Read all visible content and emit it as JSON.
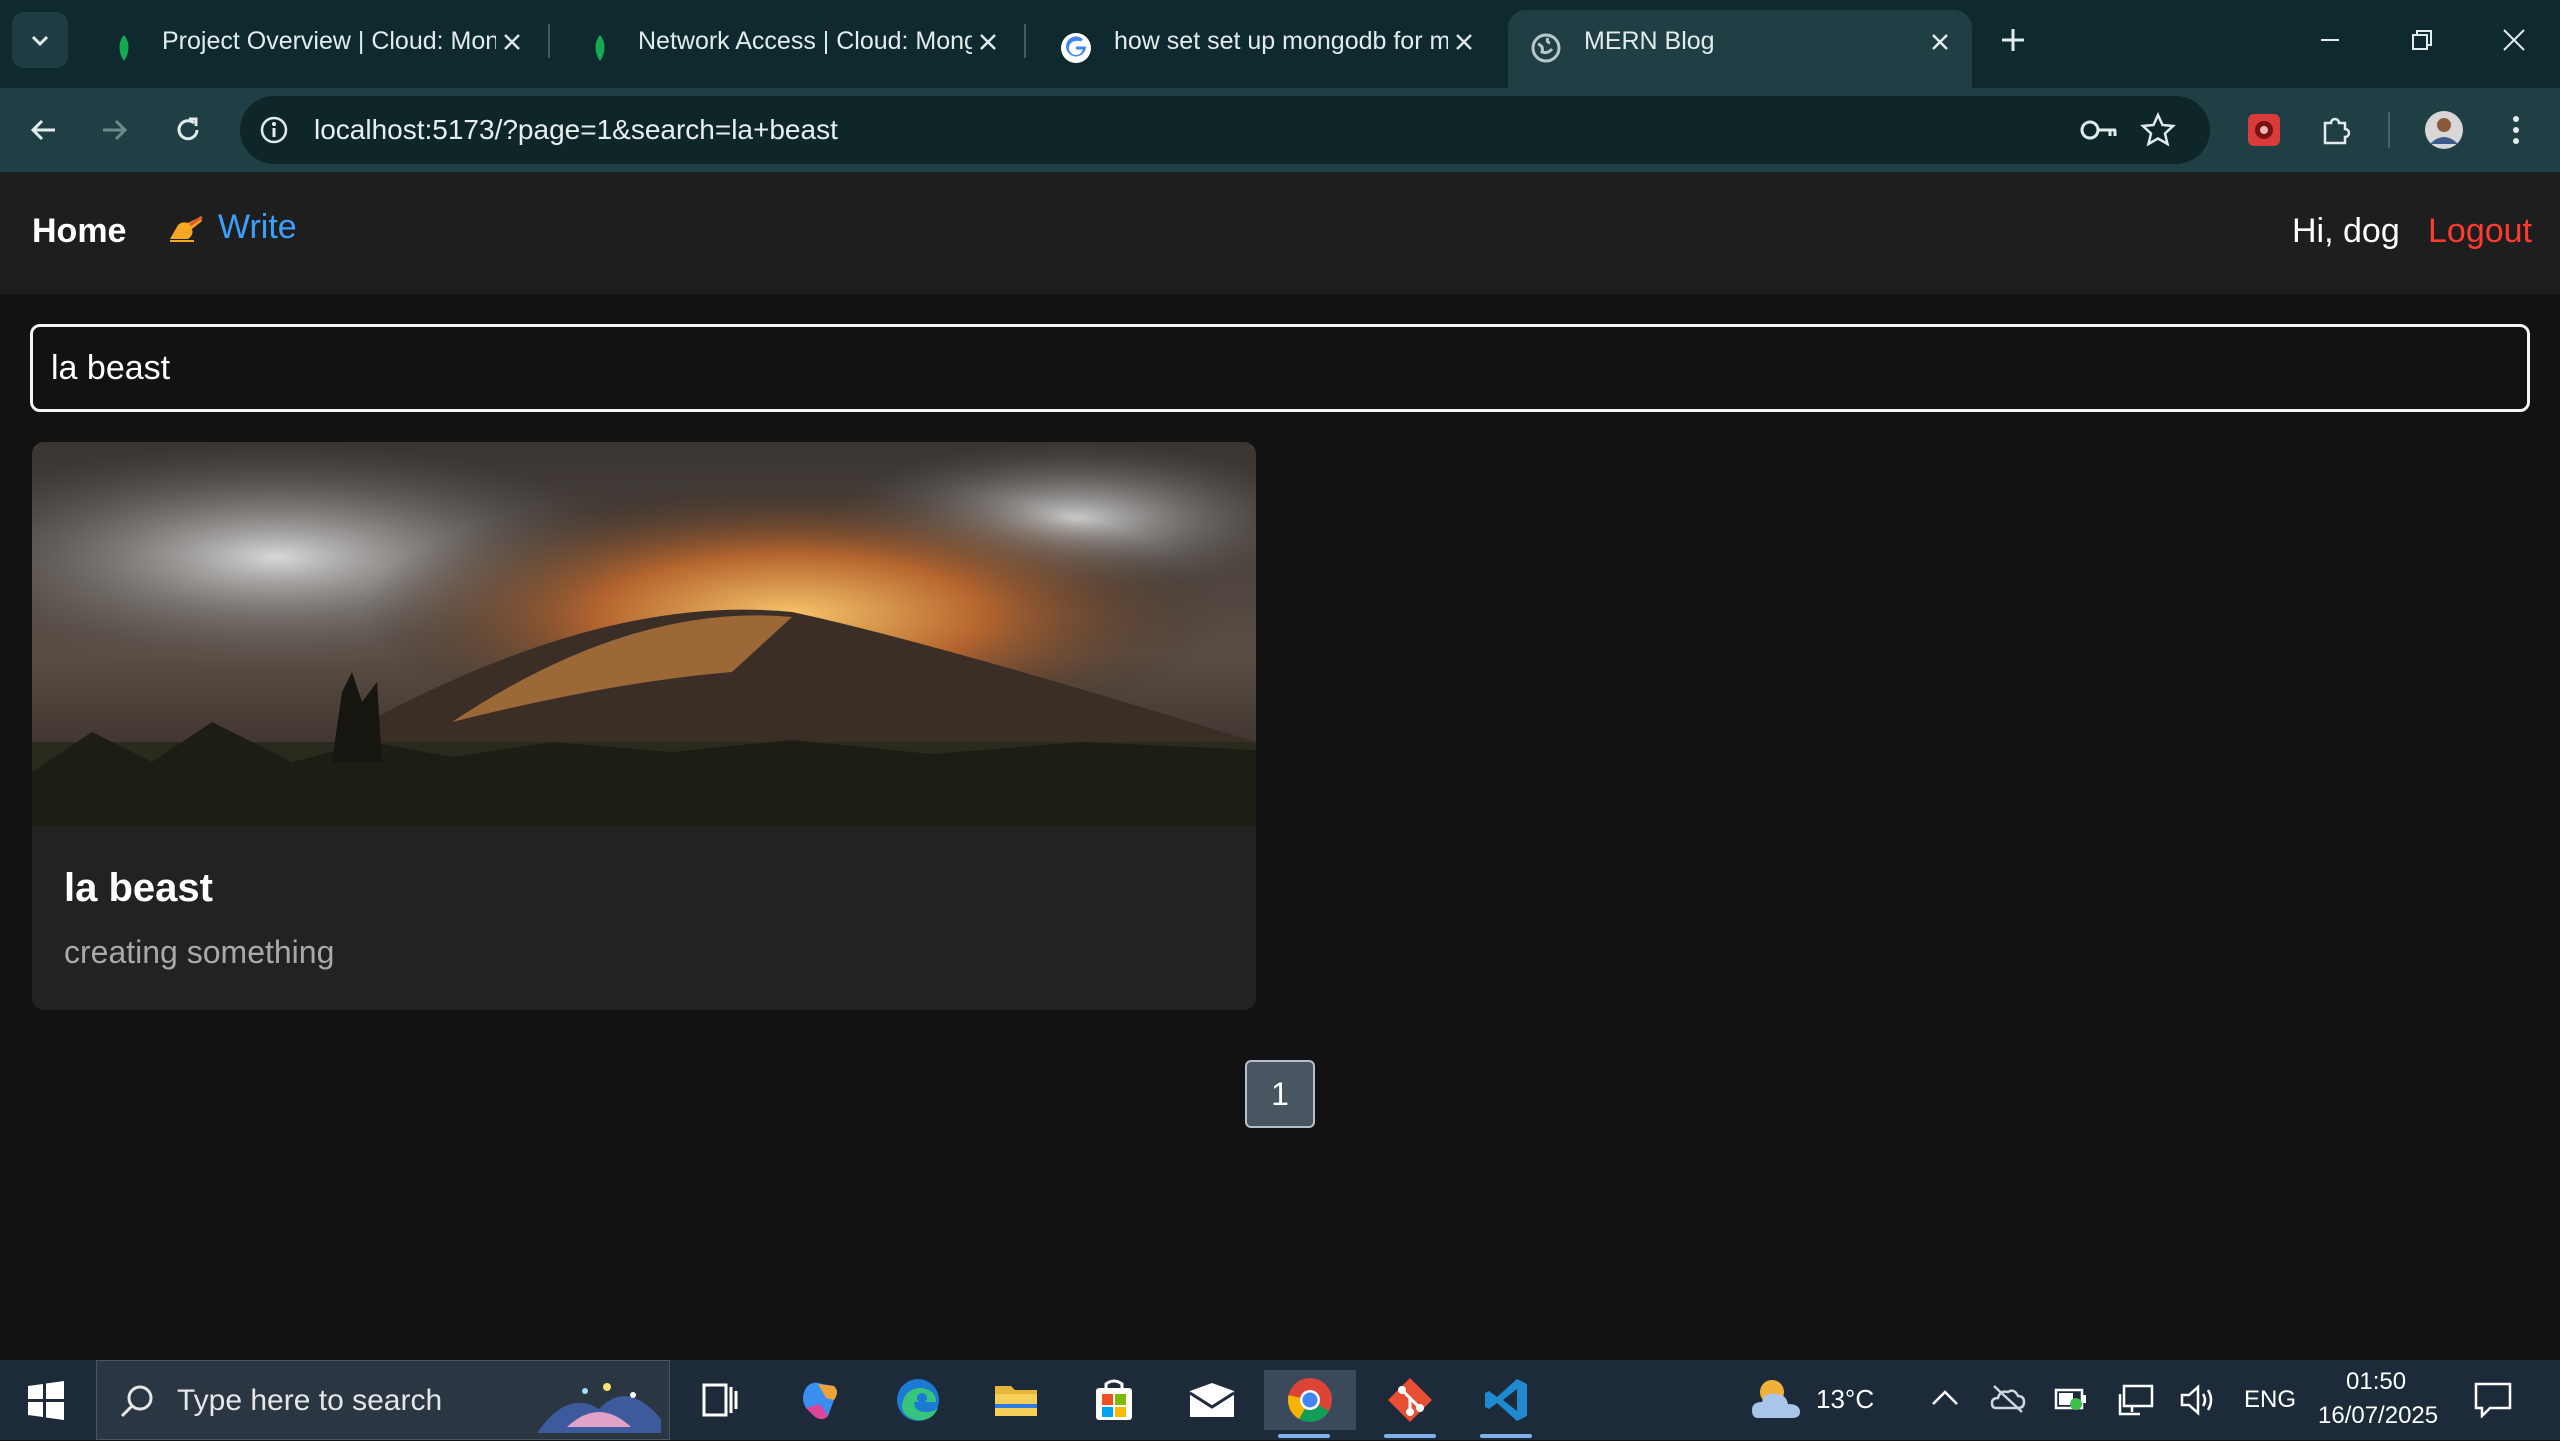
{
  "browser": {
    "tabs": [
      {
        "title": "Project Overview | Cloud: Mong",
        "icon": "mongodb-leaf-icon",
        "active": false
      },
      {
        "title": "Network Access | Cloud: Mongo",
        "icon": "mongodb-leaf-icon",
        "active": false
      },
      {
        "title": "how set set up mongodb for my",
        "icon": "google-icon",
        "active": false
      },
      {
        "title": "MERN Blog",
        "icon": "globe-icon",
        "active": true
      }
    ],
    "url": "localhost:5173/?page=1&search=la+beast"
  },
  "nav": {
    "home": "Home",
    "write": "Write",
    "greeting": "Hi, dog",
    "logout": "Logout"
  },
  "search": {
    "value": "la beast"
  },
  "posts": [
    {
      "title": "la beast",
      "summary": "creating something"
    }
  ],
  "pagination": {
    "pages": [
      "1"
    ],
    "current": "1"
  },
  "taskbar": {
    "search_placeholder": "Type here to search",
    "weather": "13°C",
    "language": "ENG",
    "time": "01:50",
    "date": "16/07/2025"
  },
  "colors": {
    "chrome_tabstrip": "#0e2a2f",
    "chrome_toolbar": "#1f3f44",
    "page_bg": "#121212",
    "navbar_bg": "#1e1e1e",
    "card_bg": "#222222",
    "write_link": "#3aa0ff",
    "logout_link": "#ff3b30",
    "taskbar_bg": "#1c2a3a"
  }
}
